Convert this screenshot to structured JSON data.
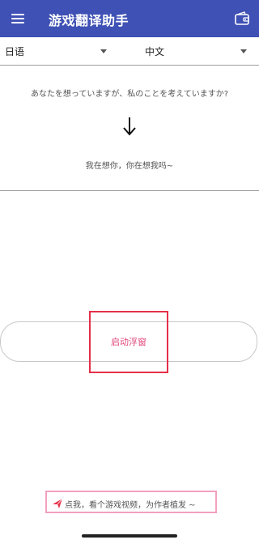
{
  "app_bar": {
    "title": "游戏翻译助手",
    "menu_icon": "menu-icon",
    "wallet_icon": "wallet-icon",
    "color": "#3f51b5"
  },
  "languages": {
    "source": "日语",
    "target": "中文"
  },
  "translation": {
    "source_text": "あなたを想っていますが、私のことを考えていますか?",
    "result_text": "我在想你，你在想我吗~",
    "arrow_icon": "arrow-down-icon"
  },
  "actions": {
    "start_float": "启动浮窗",
    "promo": "点我，看个游戏视频，为作者植发 ~",
    "promo_icon": "paper-plane-icon",
    "accent_color": "#e0457b"
  }
}
